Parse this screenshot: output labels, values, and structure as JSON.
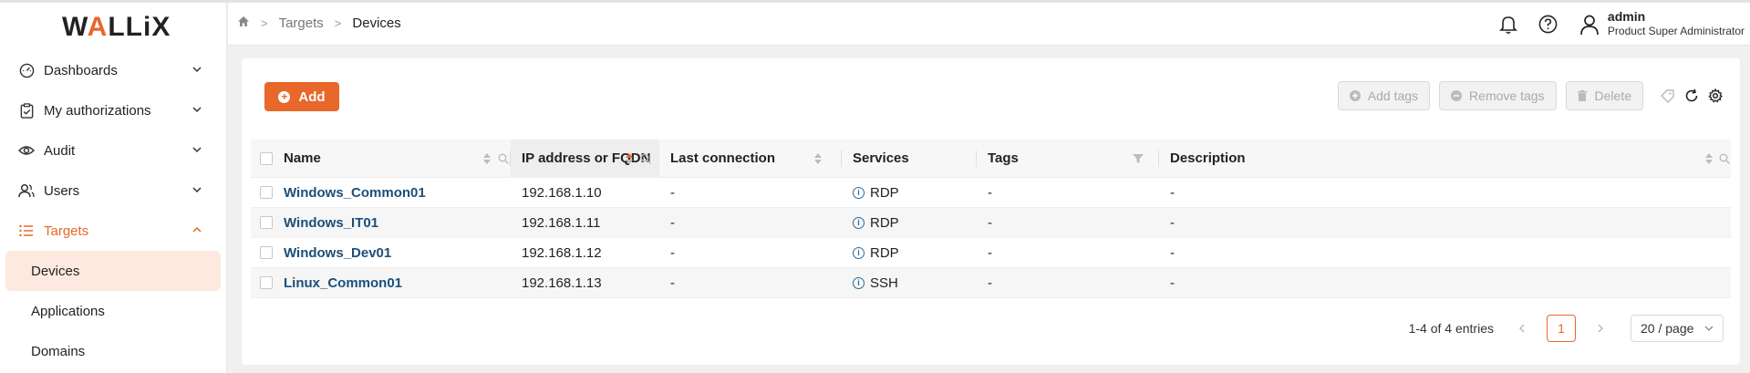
{
  "brand": {
    "logo_left": "W",
    "logo_accent": "A",
    "logo_right": "LLiX",
    "accent_color": "#e8672a"
  },
  "sidebar": {
    "items": [
      {
        "label": "Dashboards",
        "icon": "gauge-icon"
      },
      {
        "label": "My authorizations",
        "icon": "clipboard-check-icon"
      },
      {
        "label": "Audit",
        "icon": "eye-icon"
      },
      {
        "label": "Users",
        "icon": "users-icon"
      },
      {
        "label": "Targets",
        "icon": "list-icon"
      }
    ],
    "targets_sub": [
      "Devices",
      "Applications",
      "Domains"
    ]
  },
  "header": {
    "breadcrumb": [
      "Targets",
      "Devices"
    ],
    "user_name": "admin",
    "user_role": "Product Super Administrator"
  },
  "toolbar": {
    "add_label": "Add",
    "add_tags_label": "Add tags",
    "remove_tags_label": "Remove tags",
    "delete_label": "Delete"
  },
  "table": {
    "columns": [
      "Name",
      "IP address or FQDN",
      "Last connection",
      "Services",
      "Tags",
      "Description"
    ],
    "rows": [
      {
        "name": "Windows_Common01",
        "ip": "192.168.1.10",
        "last": "-",
        "service": "RDP",
        "tags": "-",
        "desc": "-"
      },
      {
        "name": "Windows_IT01",
        "ip": "192.168.1.11",
        "last": "-",
        "service": "RDP",
        "tags": "-",
        "desc": "-"
      },
      {
        "name": "Windows_Dev01",
        "ip": "192.168.1.12",
        "last": "-",
        "service": "RDP",
        "tags": "-",
        "desc": "-"
      },
      {
        "name": "Linux_Common01",
        "ip": "192.168.1.13",
        "last": "-",
        "service": "SSH",
        "tags": "-",
        "desc": "-"
      }
    ]
  },
  "pagination": {
    "range": "1-4 of 4 entries",
    "page": "1",
    "page_size": "20 / page"
  }
}
